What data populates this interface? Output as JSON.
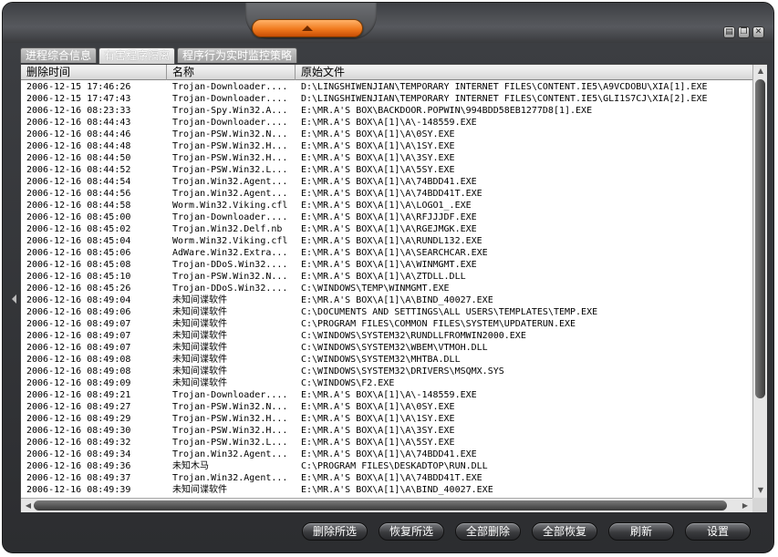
{
  "window": {
    "controls": [
      {
        "name": "menu",
        "glyph": "▤"
      },
      {
        "name": "restore",
        "glyph": "❐"
      },
      {
        "name": "close",
        "glyph": "✕"
      }
    ]
  },
  "tabs": [
    {
      "label": "进程综合信息",
      "active": false
    },
    {
      "label": "有害程序隔离",
      "active": true
    },
    {
      "label": "程序行为实时监控策略",
      "active": false
    }
  ],
  "table": {
    "columns": [
      "删除时间",
      "名称",
      "原始文件"
    ],
    "rows": [
      [
        "2006-12-15 17:46:26",
        "Trojan-Downloader....",
        "D:\\LINGSHIWENJIAN\\TEMPORARY INTERNET FILES\\CONTENT.IE5\\A9VCDOBU\\XIA[1].EXE"
      ],
      [
        "2006-12-15 17:47:43",
        "Trojan-Downloader....",
        "D:\\LINGSHIWENJIAN\\TEMPORARY INTERNET FILES\\CONTENT.IE5\\GLI1S7CJ\\XIA[2].EXE"
      ],
      [
        "2006-12-16 08:23:33",
        "Trojan-Spy.Win32.A...",
        "E:\\MR.A'S BOX\\BACKDOOR.POPWIN\\994BDD58EB1277D8[1].EXE"
      ],
      [
        "2006-12-16 08:44:43",
        "Trojan-Downloader....",
        "E:\\MR.A'S BOX\\A[1]\\A\\-148559.EXE"
      ],
      [
        "2006-12-16 08:44:46",
        "Trojan-PSW.Win32.N...",
        "E:\\MR.A'S BOX\\A[1]\\A\\0SY.EXE"
      ],
      [
        "2006-12-16 08:44:48",
        "Trojan-PSW.Win32.H...",
        "E:\\MR.A'S BOX\\A[1]\\A\\1SY.EXE"
      ],
      [
        "2006-12-16 08:44:50",
        "Trojan-PSW.Win32.H...",
        "E:\\MR.A'S BOX\\A[1]\\A\\3SY.EXE"
      ],
      [
        "2006-12-16 08:44:52",
        "Trojan-PSW.Win32.L...",
        "E:\\MR.A'S BOX\\A[1]\\A\\5SY.EXE"
      ],
      [
        "2006-12-16 08:44:54",
        "Trojan.Win32.Agent...",
        "E:\\MR.A'S BOX\\A[1]\\A\\74BDD41.EXE"
      ],
      [
        "2006-12-16 08:44:56",
        "Trojan.Win32.Agent...",
        "E:\\MR.A'S BOX\\A[1]\\A\\74BDD41T.EXE"
      ],
      [
        "2006-12-16 08:44:58",
        "Worm.Win32.Viking.cfl",
        "E:\\MR.A'S BOX\\A[1]\\A\\LOGO1_.EXE"
      ],
      [
        "2006-12-16 08:45:00",
        "Trojan-Downloader....",
        "E:\\MR.A'S BOX\\A[1]\\A\\RFJJJDF.EXE"
      ],
      [
        "2006-12-16 08:45:02",
        "Trojan.Win32.Delf.nb",
        "E:\\MR.A'S BOX\\A[1]\\A\\RGEJMGK.EXE"
      ],
      [
        "2006-12-16 08:45:04",
        "Worm.Win32.Viking.cfl",
        "E:\\MR.A'S BOX\\A[1]\\A\\RUNDL132.EXE"
      ],
      [
        "2006-12-16 08:45:06",
        "AdWare.Win32.Extra...",
        "E:\\MR.A'S BOX\\A[1]\\A\\SEARCHCAR.EXE"
      ],
      [
        "2006-12-16 08:45:08",
        "Trojan-DDoS.Win32....",
        "E:\\MR.A'S BOX\\A[1]\\A\\WINMGMT.EXE"
      ],
      [
        "2006-12-16 08:45:10",
        "Trojan-PSW.Win32.N...",
        "E:\\MR.A'S BOX\\A[1]\\A\\ZTDLL.DLL"
      ],
      [
        "2006-12-16 08:45:26",
        "Trojan-DDoS.Win32....",
        "C:\\WINDOWS\\TEMP\\WINMGMT.EXE"
      ],
      [
        "2006-12-16 08:49:04",
        "未知间谍软件",
        "E:\\MR.A'S BOX\\A[1]\\A\\BIND_40027.EXE"
      ],
      [
        "2006-12-16 08:49:06",
        "未知间谍软件",
        "C:\\DOCUMENTS AND SETTINGS\\ALL USERS\\TEMPLATES\\TEMP.EXE"
      ],
      [
        "2006-12-16 08:49:07",
        "未知间谍软件",
        "C:\\PROGRAM FILES\\COMMON FILES\\SYSTEM\\UPDATERUN.EXE"
      ],
      [
        "2006-12-16 08:49:07",
        "未知间谍软件",
        "C:\\WINDOWS\\SYSTEM32\\RUNDLLFROMWIN2000.EXE"
      ],
      [
        "2006-12-16 08:49:07",
        "未知间谍软件",
        "C:\\WINDOWS\\SYSTEM32\\WBEM\\VTMOH.DLL"
      ],
      [
        "2006-12-16 08:49:08",
        "未知间谍软件",
        "C:\\WINDOWS\\SYSTEM32\\MHTBA.DLL"
      ],
      [
        "2006-12-16 08:49:08",
        "未知间谍软件",
        "C:\\WINDOWS\\SYSTEM32\\DRIVERS\\MSQMX.SYS"
      ],
      [
        "2006-12-16 08:49:09",
        "未知间谍软件",
        "C:\\WINDOWS\\F2.EXE"
      ],
      [
        "2006-12-16 08:49:21",
        "Trojan-Downloader....",
        "E:\\MR.A'S BOX\\A[1]\\A\\-148559.EXE"
      ],
      [
        "2006-12-16 08:49:27",
        "Trojan-PSW.Win32.N...",
        "E:\\MR.A'S BOX\\A[1]\\A\\0SY.EXE"
      ],
      [
        "2006-12-16 08:49:29",
        "Trojan-PSW.Win32.H...",
        "E:\\MR.A'S BOX\\A[1]\\A\\1SY.EXE"
      ],
      [
        "2006-12-16 08:49:30",
        "Trojan-PSW.Win32.H...",
        "E:\\MR.A'S BOX\\A[1]\\A\\3SY.EXE"
      ],
      [
        "2006-12-16 08:49:32",
        "Trojan-PSW.Win32.L...",
        "E:\\MR.A'S BOX\\A[1]\\A\\5SY.EXE"
      ],
      [
        "2006-12-16 08:49:34",
        "Trojan.Win32.Agent...",
        "E:\\MR.A'S BOX\\A[1]\\A\\74BDD41.EXE"
      ],
      [
        "2006-12-16 08:49:36",
        "未知木马",
        "C:\\PROGRAM FILES\\DESKADTOP\\RUN.DLL"
      ],
      [
        "2006-12-16 08:49:37",
        "Trojan.Win32.Agent...",
        "E:\\MR.A'S BOX\\A[1]\\A\\74BDD41T.EXE"
      ],
      [
        "2006-12-16 08:49:39",
        "未知间谍软件",
        "E:\\MR.A'S BOX\\A[1]\\A\\BIND_40027.EXE"
      ]
    ]
  },
  "buttons": [
    {
      "name": "delete-selected-button",
      "label": "删除所选"
    },
    {
      "name": "restore-selected-button",
      "label": "恢复所选"
    },
    {
      "name": "delete-all-button",
      "label": "全部删除"
    },
    {
      "name": "restore-all-button",
      "label": "全部恢复"
    },
    {
      "name": "refresh-button",
      "label": "刷新"
    },
    {
      "name": "settings-button",
      "label": "设置"
    }
  ]
}
